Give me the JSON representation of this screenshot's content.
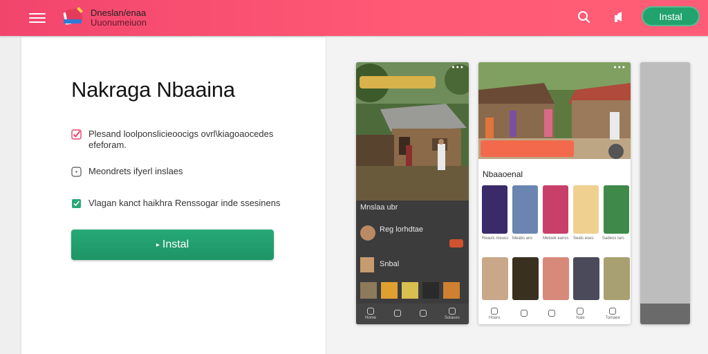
{
  "header": {
    "brand_line1": "Dneslan/enaa",
    "brand_line2": "Uuonumeiuon",
    "install_label": "Instal"
  },
  "hero": {
    "title": "Nakraga Nbaaina",
    "features": [
      {
        "text": "Plesand loolponslicieoocigs ovrl\\kiagoaocedes efeforam.",
        "check": "pink"
      },
      {
        "text": "Meondrets ifyerl inslaes",
        "check": "outline"
      },
      {
        "text": "Vlagan kanct haikhra Renssogar inde ssesinens",
        "check": "green"
      }
    ],
    "install_label": "Instal"
  },
  "screens": {
    "phone1": {
      "card_title": "Mnslaa ubr",
      "row1_title": "Reg lorhdtae",
      "row2_title": "Snbal",
      "nav": [
        "Home",
        "",
        "",
        "Sotaues"
      ]
    },
    "phone2": {
      "section_title": "Nbaaoenal",
      "captions": [
        "Reauls meuus",
        "Meabs ans",
        "Metoek eanss",
        "Seals eses",
        "Sadeos tars"
      ],
      "nav": [
        "Hoaro",
        "",
        "",
        "Naie",
        "Tomaee"
      ]
    }
  },
  "colors": {
    "header": "#ff5a75",
    "accent": "#22a36e",
    "banner": "#f26a4b"
  },
  "icons": [
    "menu-icon",
    "app-logo-icon",
    "search-icon",
    "share-icon",
    "check-icon",
    "home-icon"
  ]
}
